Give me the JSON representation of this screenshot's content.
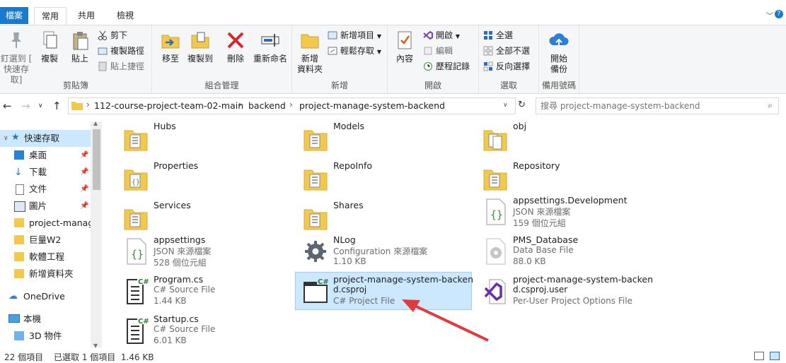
{
  "tabs": {
    "file": "檔案",
    "home": "常用",
    "share": "共用",
    "view": "檢視"
  },
  "ribbon": {
    "clipboard": {
      "label": "剪貼簿",
      "pin": [
        "釘選到 [",
        "快速存取]"
      ],
      "copy": "複製",
      "paste": "貼上",
      "cut": "剪下",
      "copy_path": "複製路徑",
      "paste_shortcut": "貼上捷徑"
    },
    "organize": {
      "label": "組合管理",
      "move_to": "移至",
      "copy_to": "複製到",
      "delete": "刪除",
      "rename": "重新命名"
    },
    "new": {
      "label": "新增",
      "new_folder": [
        "新增",
        "資料夾"
      ],
      "new_item": "新增項目",
      "easy_access": "輕鬆存取"
    },
    "open": {
      "label": "開啟",
      "properties": "內容",
      "open": "開啟",
      "edit": "編輯",
      "history": "歷程記錄"
    },
    "select": {
      "label": "選取",
      "select_all": "全選",
      "select_none": "全部不選",
      "invert": "反向選擇"
    },
    "backup": {
      "label": "備用號碼",
      "start": [
        "開始",
        "備份"
      ]
    }
  },
  "address": {
    "crumbs": [
      "112-course-project-team-02-main",
      "backend",
      "project-manage-system-backend"
    ],
    "search_placeholder": "搜尋 project-manage-system-backend"
  },
  "nav": {
    "quick_access": "快速存取",
    "items": [
      {
        "label": "桌面",
        "pinned": true
      },
      {
        "label": "下載",
        "pinned": true
      },
      {
        "label": "文件",
        "pinned": true
      },
      {
        "label": "圖片",
        "pinned": true
      },
      {
        "label": "project-manag",
        "pinned": false
      },
      {
        "label": "巨量W2",
        "pinned": false
      },
      {
        "label": "軟體工程",
        "pinned": false
      },
      {
        "label": "新增資料夾",
        "pinned": false
      }
    ],
    "onedrive": "OneDrive",
    "this_pc": "本機",
    "objects3d": "3D 物件"
  },
  "files": [
    {
      "name": "Hubs",
      "type": "",
      "size": ""
    },
    {
      "name": "Models",
      "type": "",
      "size": ""
    },
    {
      "name": "obj",
      "type": "",
      "size": ""
    },
    {
      "name": "Properties",
      "type": "",
      "size": ""
    },
    {
      "name": "RepoInfo",
      "type": "",
      "size": ""
    },
    {
      "name": "Repository",
      "type": "",
      "size": ""
    },
    {
      "name": "Services",
      "type": "",
      "size": ""
    },
    {
      "name": "Shares",
      "type": "",
      "size": ""
    },
    {
      "name": "appsettings.Development",
      "type": "JSON 來源檔案",
      "size": "159 個位元組"
    },
    {
      "name": "appsettings",
      "type": "JSON 來源檔案",
      "size": "528 個位元組"
    },
    {
      "name": "NLog",
      "type": "Configuration 來源檔案",
      "size": "1.10 KB"
    },
    {
      "name": "PMS_Database",
      "type": "Data Base File",
      "size": "88.0 KB"
    },
    {
      "name": "Program.cs",
      "type": "C# Source File",
      "size": "1.44 KB"
    },
    {
      "name": "project-manage-system-backen",
      "name2": "d.csproj",
      "type": "C# Project File",
      "size": ""
    },
    {
      "name": "project-manage-system-backen",
      "name2": "d.csproj.user",
      "type": "Per-User Project Options File",
      "size": ""
    },
    {
      "name": "Startup.cs",
      "type": "C# Source File",
      "size": "6.01 KB"
    }
  ],
  "status": {
    "count": "22 個項目",
    "selected": "已選取 1 個項目  1.46 KB"
  },
  "colors": {
    "accent": "#1979ca",
    "selection": "#cce8ff",
    "arrow": "#e03a3a",
    "folder": "#f2c94c"
  }
}
